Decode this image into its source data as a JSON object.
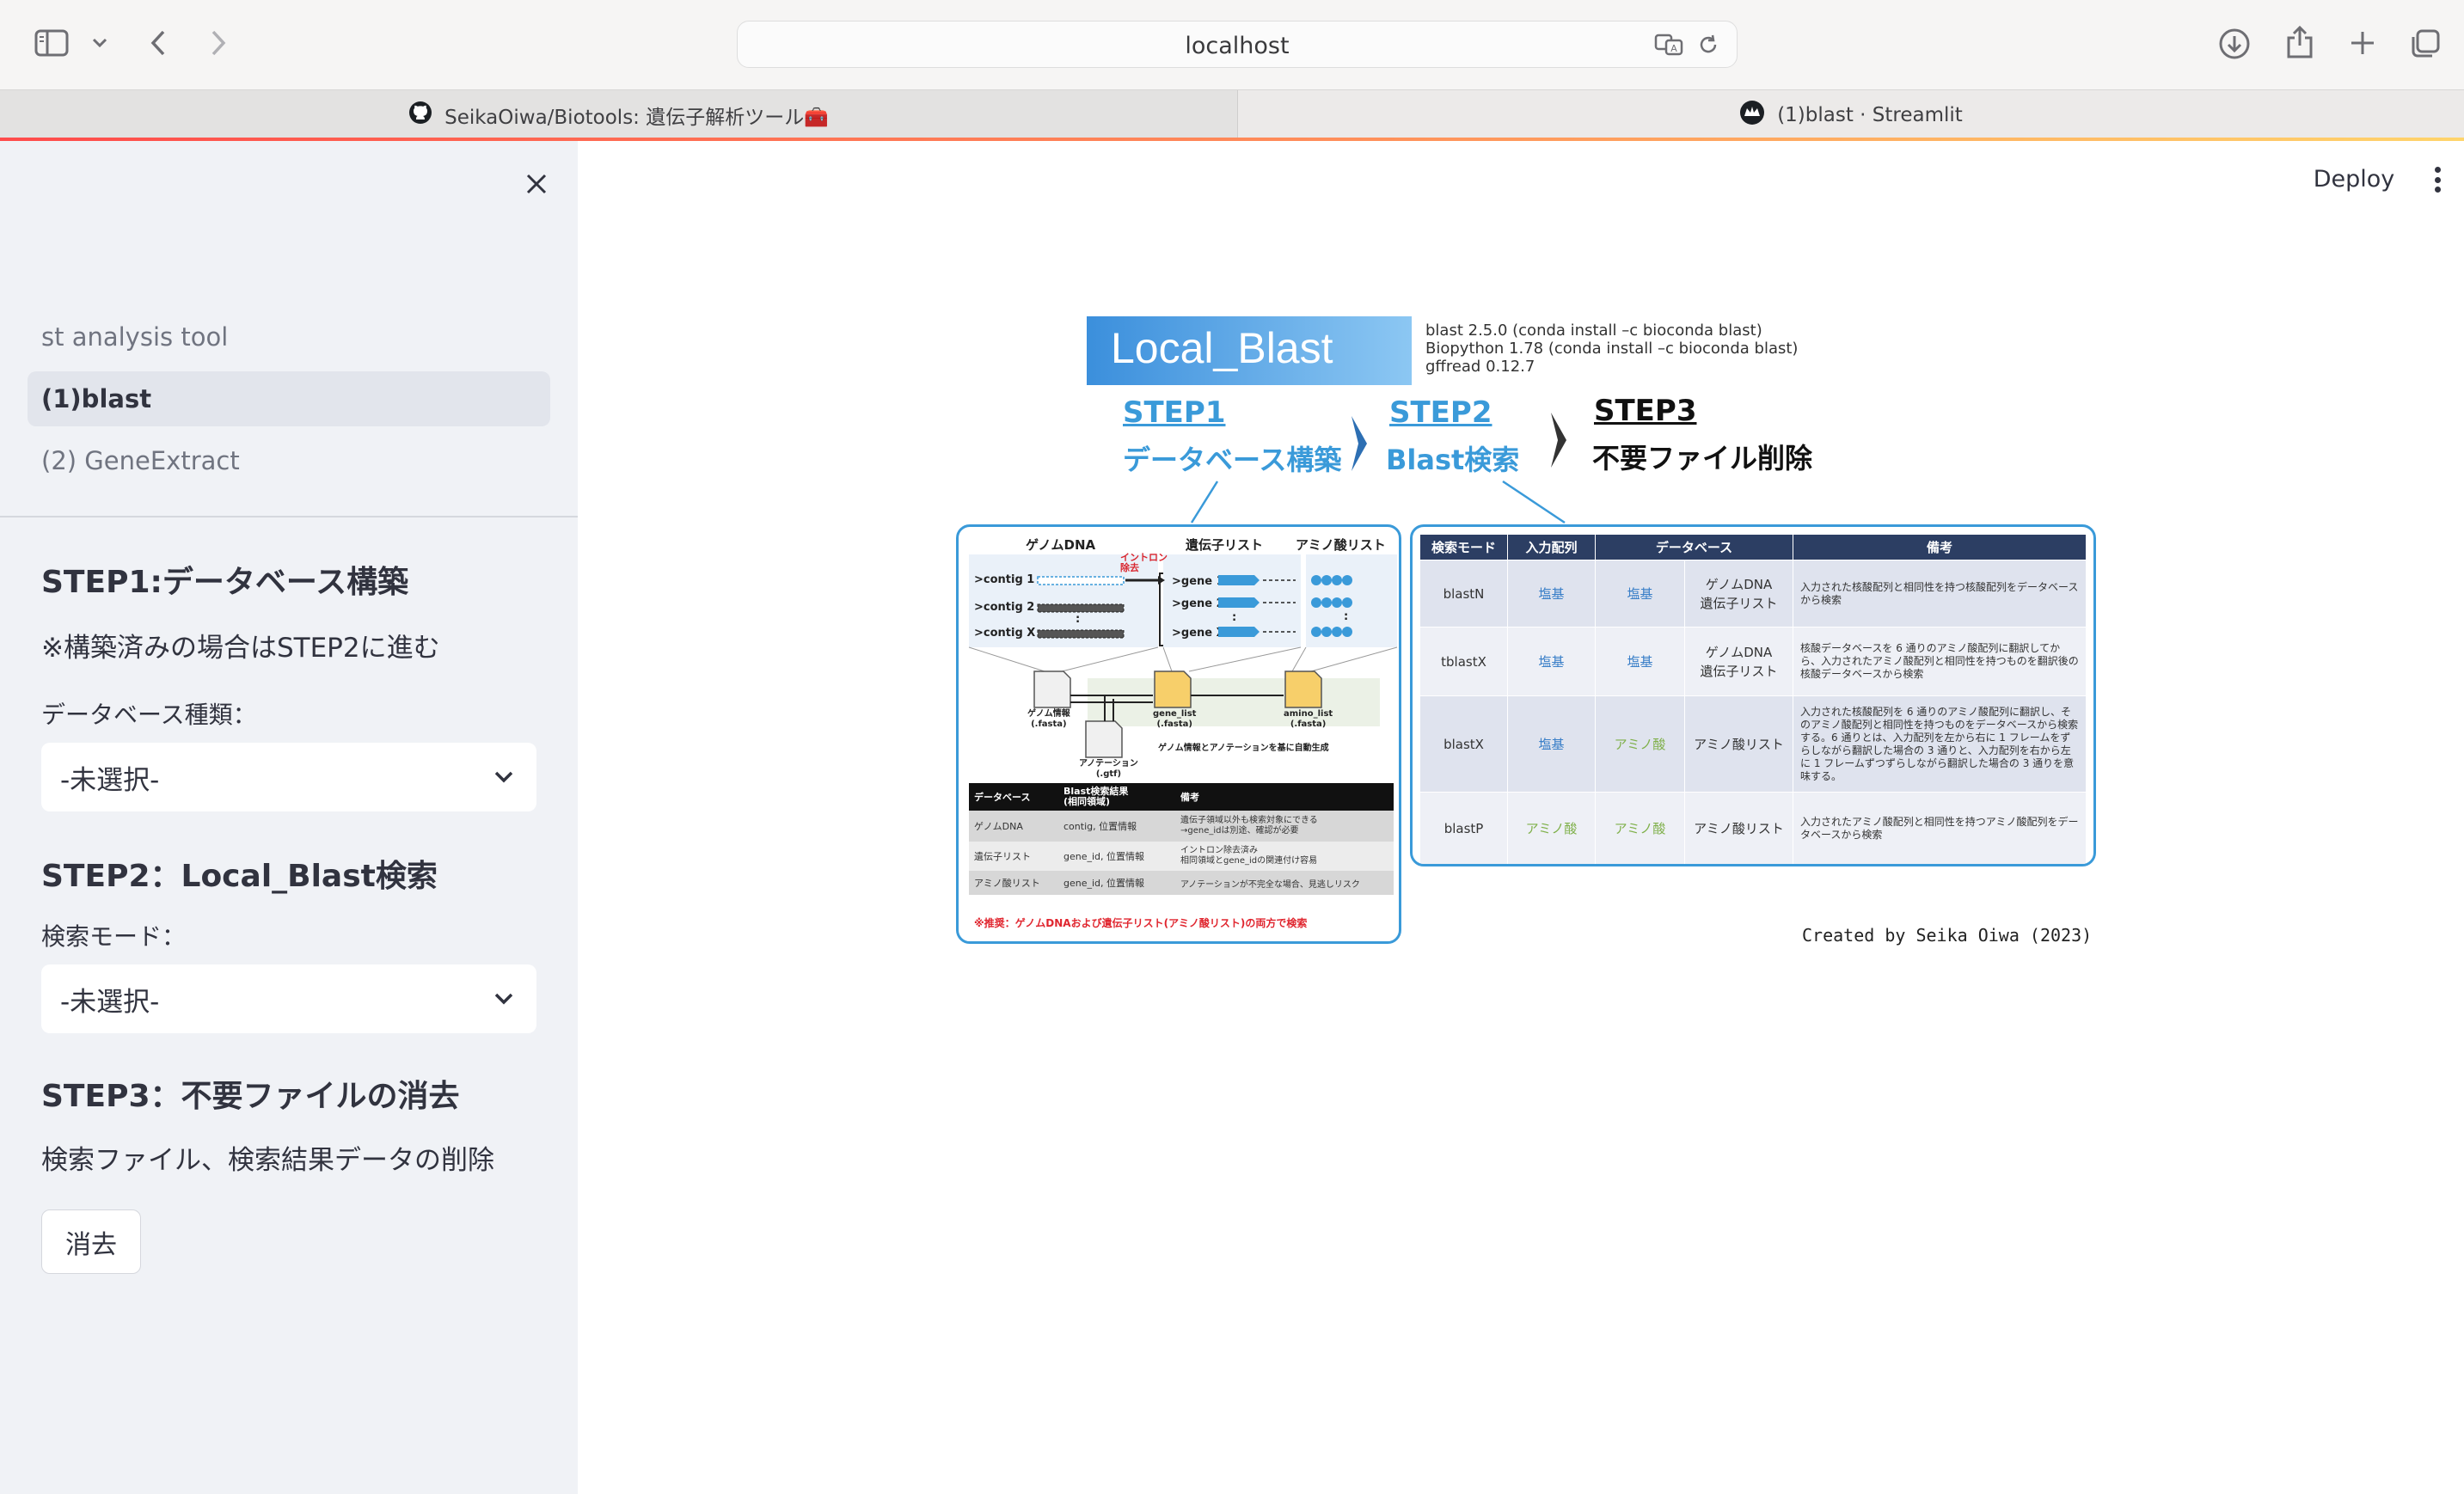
{
  "browser": {
    "url": "localhost",
    "tabs": [
      {
        "label": "SeikaOiwa/Biotools: 遺伝子解析ツール🧰"
      },
      {
        "label": "(1)blast · Streamlit"
      }
    ]
  },
  "sidebar": {
    "nav": [
      {
        "label": "st analysis tool"
      },
      {
        "label": "(1)blast"
      },
      {
        "label": "(2) GeneExtract"
      }
    ],
    "step1": {
      "heading": "STEP1:データベース構築",
      "note": "※構築済みの場合はSTEP2に進む",
      "db_label": "データベース種類：",
      "db_value": "-未選択-"
    },
    "step2": {
      "heading": "STEP2：Local_Blast検索",
      "mode_label": "検索モード：",
      "mode_value": "-未選択-"
    },
    "step3": {
      "heading": "STEP3：不要ファイルの消去",
      "desc": "検索ファイル、検索結果データの削除",
      "button": "消去"
    }
  },
  "header": {
    "deploy": "Deploy"
  },
  "figure": {
    "title": "Local_Blast",
    "versions": [
      "blast 2.5.0  (conda install –c bioconda blast)",
      "Biopython 1.78  (conda install –c bioconda blast)",
      "gffread 0.12.7"
    ],
    "step1": {
      "label": "STEP1",
      "sub": "データベース構築"
    },
    "step2": {
      "label": "STEP2",
      "sub": "Blast検索"
    },
    "step3": {
      "label": "STEP3",
      "sub": "不要ファイル削除"
    },
    "left_panel": {
      "col_headers": [
        "ゲノムDNA",
        "遺伝子リスト",
        "アミノ酸リスト"
      ],
      "intron_label": "イントロン\n除去",
      "contigs": [
        ">contig 1",
        ">contig 2",
        ":",
        ">contig X"
      ],
      "genes": [
        ">gene 1",
        ">gene 2",
        ":",
        ">gene X"
      ],
      "files": {
        "genome": "ゲノム情報\n(.fasta)",
        "annotation": "アノテーション\n(.gtf)",
        "gene_list": "gene_list\n(.fasta)",
        "amino_list": "amino_list\n(.fasta)"
      },
      "auto_note": "ゲノム情報とアノテーションを基に自動生成",
      "table_headers": [
        "データベース",
        "Blast検索結果\n(相同領域)",
        "備考"
      ],
      "table_rows": [
        [
          "ゲノムDNA",
          "contig, 位置情報",
          "遺伝子領域以外も検索対象にできる\n→gene_idは別途、確認が必要"
        ],
        [
          "遺伝子リスト",
          "gene_id, 位置情報",
          "イントロン除去済み\n相同領域とgene_idの関連付け容易"
        ],
        [
          "アミノ酸リスト",
          "gene_id, 位置情報",
          "アノテーションが不完全な場合、見逃しリスク"
        ]
      ],
      "recommend": "※推奨：ゲノムDNAおよび遺伝子リスト(アミノ酸リスト)の両方で検索"
    },
    "right_table": {
      "headers": [
        "検索モード",
        "入力配列",
        "データベース",
        "備考"
      ],
      "rows": [
        {
          "mode": "blastN",
          "input": "塩基",
          "db": "塩基",
          "db_type": "ゲノムDNA\n遺伝子リスト",
          "note": "入力された核酸配列と相同性を持つ核酸配列をデータベースから検索"
        },
        {
          "mode": "tblastX",
          "input": "塩基",
          "db": "塩基",
          "db_type": "ゲノムDNA\n遺伝子リスト",
          "note": "核酸データベースを 6 通りのアミノ酸配列に翻訳してから、入力されたアミノ酸配列と相同性を持つものを翻訳後の核酸データベースから検索"
        },
        {
          "mode": "blastX",
          "input": "塩基",
          "db": "アミノ酸",
          "db_type": "アミノ酸リスト",
          "note": "入力された核酸配列を 6 通りのアミノ酸配列に翻訳し、そのアミノ酸配列と相同性を持つものをデータベースから検索する。6 通りとは、入力配列を左から右に 1 フレームをずらしながら翻訳した場合の 3 通りと、入力配列を右から左に 1 フレームずつずらしながら翻訳した場合の 3 通りを意味する。"
        },
        {
          "mode": "blastP",
          "input": "アミノ酸",
          "db": "アミノ酸",
          "db_type": "アミノ酸リスト",
          "note": "入力されたアミノ酸配列と相同性を持つアミノ酸配列をデータベースから検索"
        }
      ]
    },
    "credit": "Created by Seika Oiwa (2023)"
  },
  "colors": {
    "accent": "#ff4b4b",
    "figure_blue": "#3a9ad9",
    "header_navy": "#2c3e63",
    "sidebar_bg": "#f0f2f6"
  }
}
